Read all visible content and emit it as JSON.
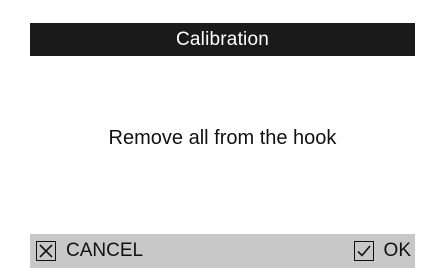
{
  "dialog": {
    "title": "Calibration",
    "message": "Remove all from the hook"
  },
  "actions": {
    "cancel_label": "CANCEL",
    "cancel_icon": "close-box-icon",
    "ok_label": "OK",
    "ok_icon": "checkmark-box-icon"
  },
  "colors": {
    "title_bar_bg": "#1a1a1a",
    "title_text": "#ffffff",
    "bottom_bar_bg": "#c8c8c8",
    "text": "#111111",
    "background": "#ffffff"
  }
}
